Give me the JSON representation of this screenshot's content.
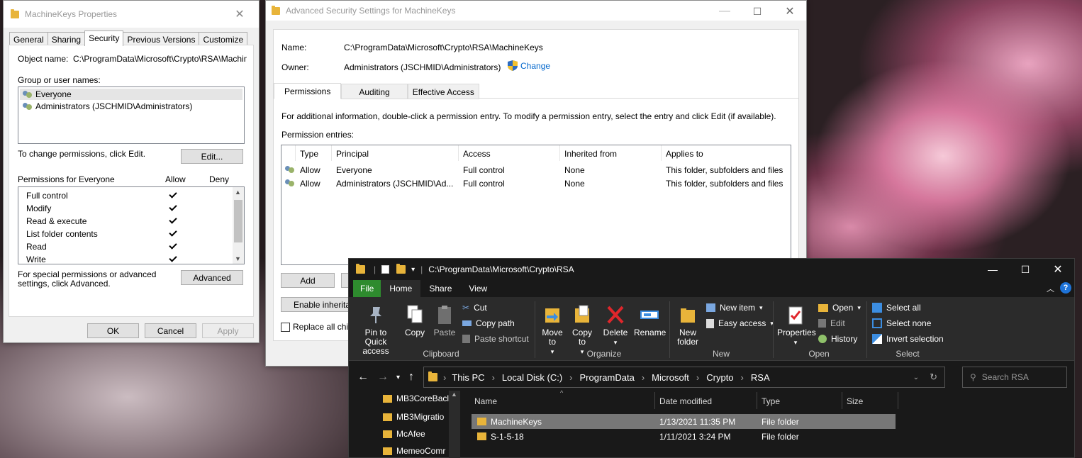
{
  "props": {
    "title": "MachineKeys Properties",
    "tabs": [
      "General",
      "Sharing",
      "Security",
      "Previous Versions",
      "Customize"
    ],
    "object_label": "Object name:",
    "object_value": "C:\\ProgramData\\Microsoft\\Crypto\\RSA\\MachineK",
    "group_label": "Group or user names:",
    "users": [
      "Everyone",
      "Administrators (JSCHMID\\Administrators)"
    ],
    "change_text": "To change permissions, click Edit.",
    "edit_btn": "Edit...",
    "perm_for": "Permissions for Everyone",
    "allow": "Allow",
    "deny": "Deny",
    "permissions": [
      "Full control",
      "Modify",
      "Read & execute",
      "List folder contents",
      "Read",
      "Write"
    ],
    "special_text": "For special permissions or advanced settings, click Advanced.",
    "advanced_btn": "Advanced",
    "ok": "OK",
    "cancel": "Cancel",
    "apply": "Apply"
  },
  "adv": {
    "title": "Advanced Security Settings for MachineKeys",
    "name_label": "Name:",
    "name_value": "C:\\ProgramData\\Microsoft\\Crypto\\RSA\\MachineKeys",
    "owner_label": "Owner:",
    "owner_value": "Administrators (JSCHMID\\Administrators)",
    "change": "Change",
    "tabs": [
      "Permissions",
      "Auditing",
      "Effective Access"
    ],
    "info": "For additional information, double-click a permission entry. To modify a permission entry, select the entry and click Edit (if available).",
    "entries_label": "Permission entries:",
    "columns": [
      "Type",
      "Principal",
      "Access",
      "Inherited from",
      "Applies to"
    ],
    "rows": [
      [
        "Allow",
        "Everyone",
        "Full control",
        "None",
        "This folder, subfolders and files"
      ],
      [
        "Allow",
        "Administrators (JSCHMID\\Ad...",
        "Full control",
        "None",
        "This folder, subfolders and files"
      ]
    ],
    "add": "Add",
    "enable_inherit": "Enable inherita",
    "replace": "Replace all chil"
  },
  "explorer": {
    "title": "C:\\ProgramData\\Microsoft\\Crypto\\RSA",
    "ribbon_tabs": [
      "File",
      "Home",
      "Share",
      "View"
    ],
    "clipboard": {
      "pin": "Pin to Quick access",
      "copy": "Copy",
      "paste": "Paste",
      "cut": "Cut",
      "copy_path": "Copy path",
      "paste_shortcut": "Paste shortcut",
      "group": "Clipboard"
    },
    "organize": {
      "move": "Move to",
      "copy_to": "Copy to",
      "delete": "Delete",
      "rename": "Rename",
      "group": "Organize"
    },
    "new": {
      "new_folder": "New folder",
      "new_item": "New item",
      "easy_access": "Easy access",
      "group": "New"
    },
    "open": {
      "properties": "Properties",
      "open": "Open",
      "edit": "Edit",
      "history": "History",
      "group": "Open"
    },
    "select": {
      "select_all": "Select all",
      "select_none": "Select none",
      "invert": "Invert selection",
      "group": "Select"
    },
    "breadcrumb": [
      "This PC",
      "Local Disk (C:)",
      "ProgramData",
      "Microsoft",
      "Crypto",
      "RSA"
    ],
    "search_placeholder": "Search RSA",
    "sidebar": [
      "MB3CoreBacl",
      "MB3Migratio",
      "McAfee",
      "MemeoComr"
    ],
    "columns": [
      "Name",
      "Date modified",
      "Type",
      "Size"
    ],
    "files": [
      {
        "name": "MachineKeys",
        "date": "1/13/2021 11:35 PM",
        "type": "File folder"
      },
      {
        "name": "S-1-5-18",
        "date": "1/11/2021 3:24 PM",
        "type": "File folder"
      }
    ]
  }
}
